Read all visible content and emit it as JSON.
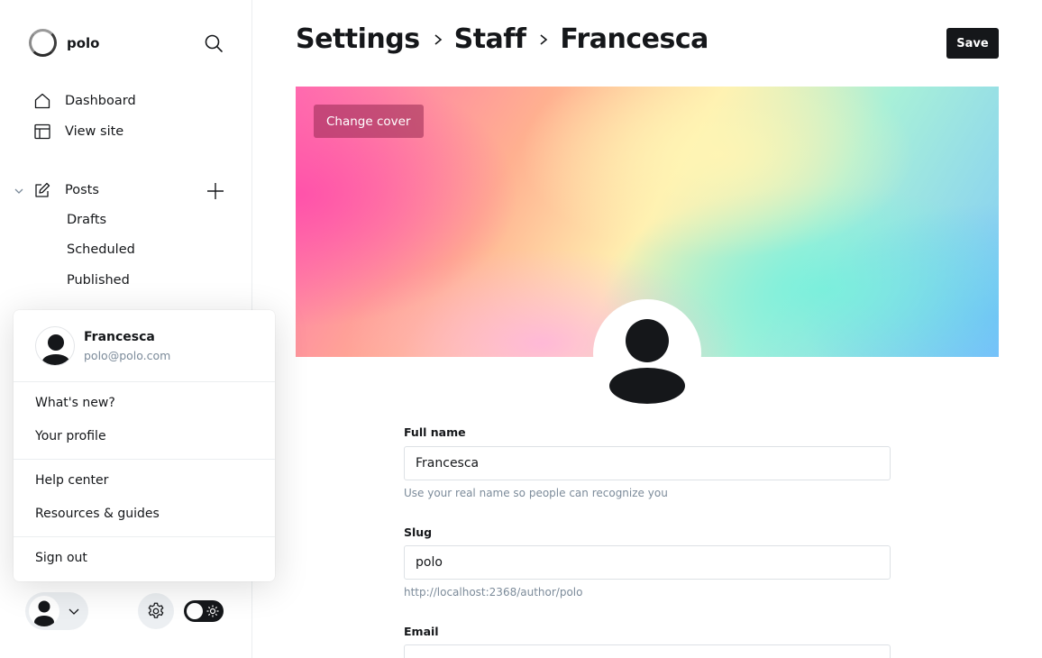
{
  "brand": {
    "name": "polo"
  },
  "nav": {
    "dashboard": "Dashboard",
    "view_site": "View site",
    "posts": "Posts",
    "drafts": "Drafts",
    "scheduled": "Scheduled",
    "published": "Published"
  },
  "popup": {
    "user_name": "Francesca",
    "user_email": "polo@polo.com",
    "whats_new": "What's new?",
    "your_profile": "Your profile",
    "help_center": "Help center",
    "resources": "Resources & guides",
    "sign_out": "Sign out"
  },
  "header": {
    "crumbs": [
      "Settings",
      "Staff",
      "Francesca"
    ],
    "save_label": "Save"
  },
  "cover": {
    "change_label": "Change cover"
  },
  "form": {
    "full_name_label": "Full name",
    "full_name_value": "Francesca",
    "full_name_hint": "Use your real name so people can recognize you",
    "slug_label": "Slug",
    "slug_value": "polo",
    "slug_hint": "http://localhost:2368/author/polo",
    "email_label": "Email"
  },
  "colors": {
    "dark": "#15171a",
    "muted": "#7c8b9a",
    "border": "#dde1e5"
  }
}
